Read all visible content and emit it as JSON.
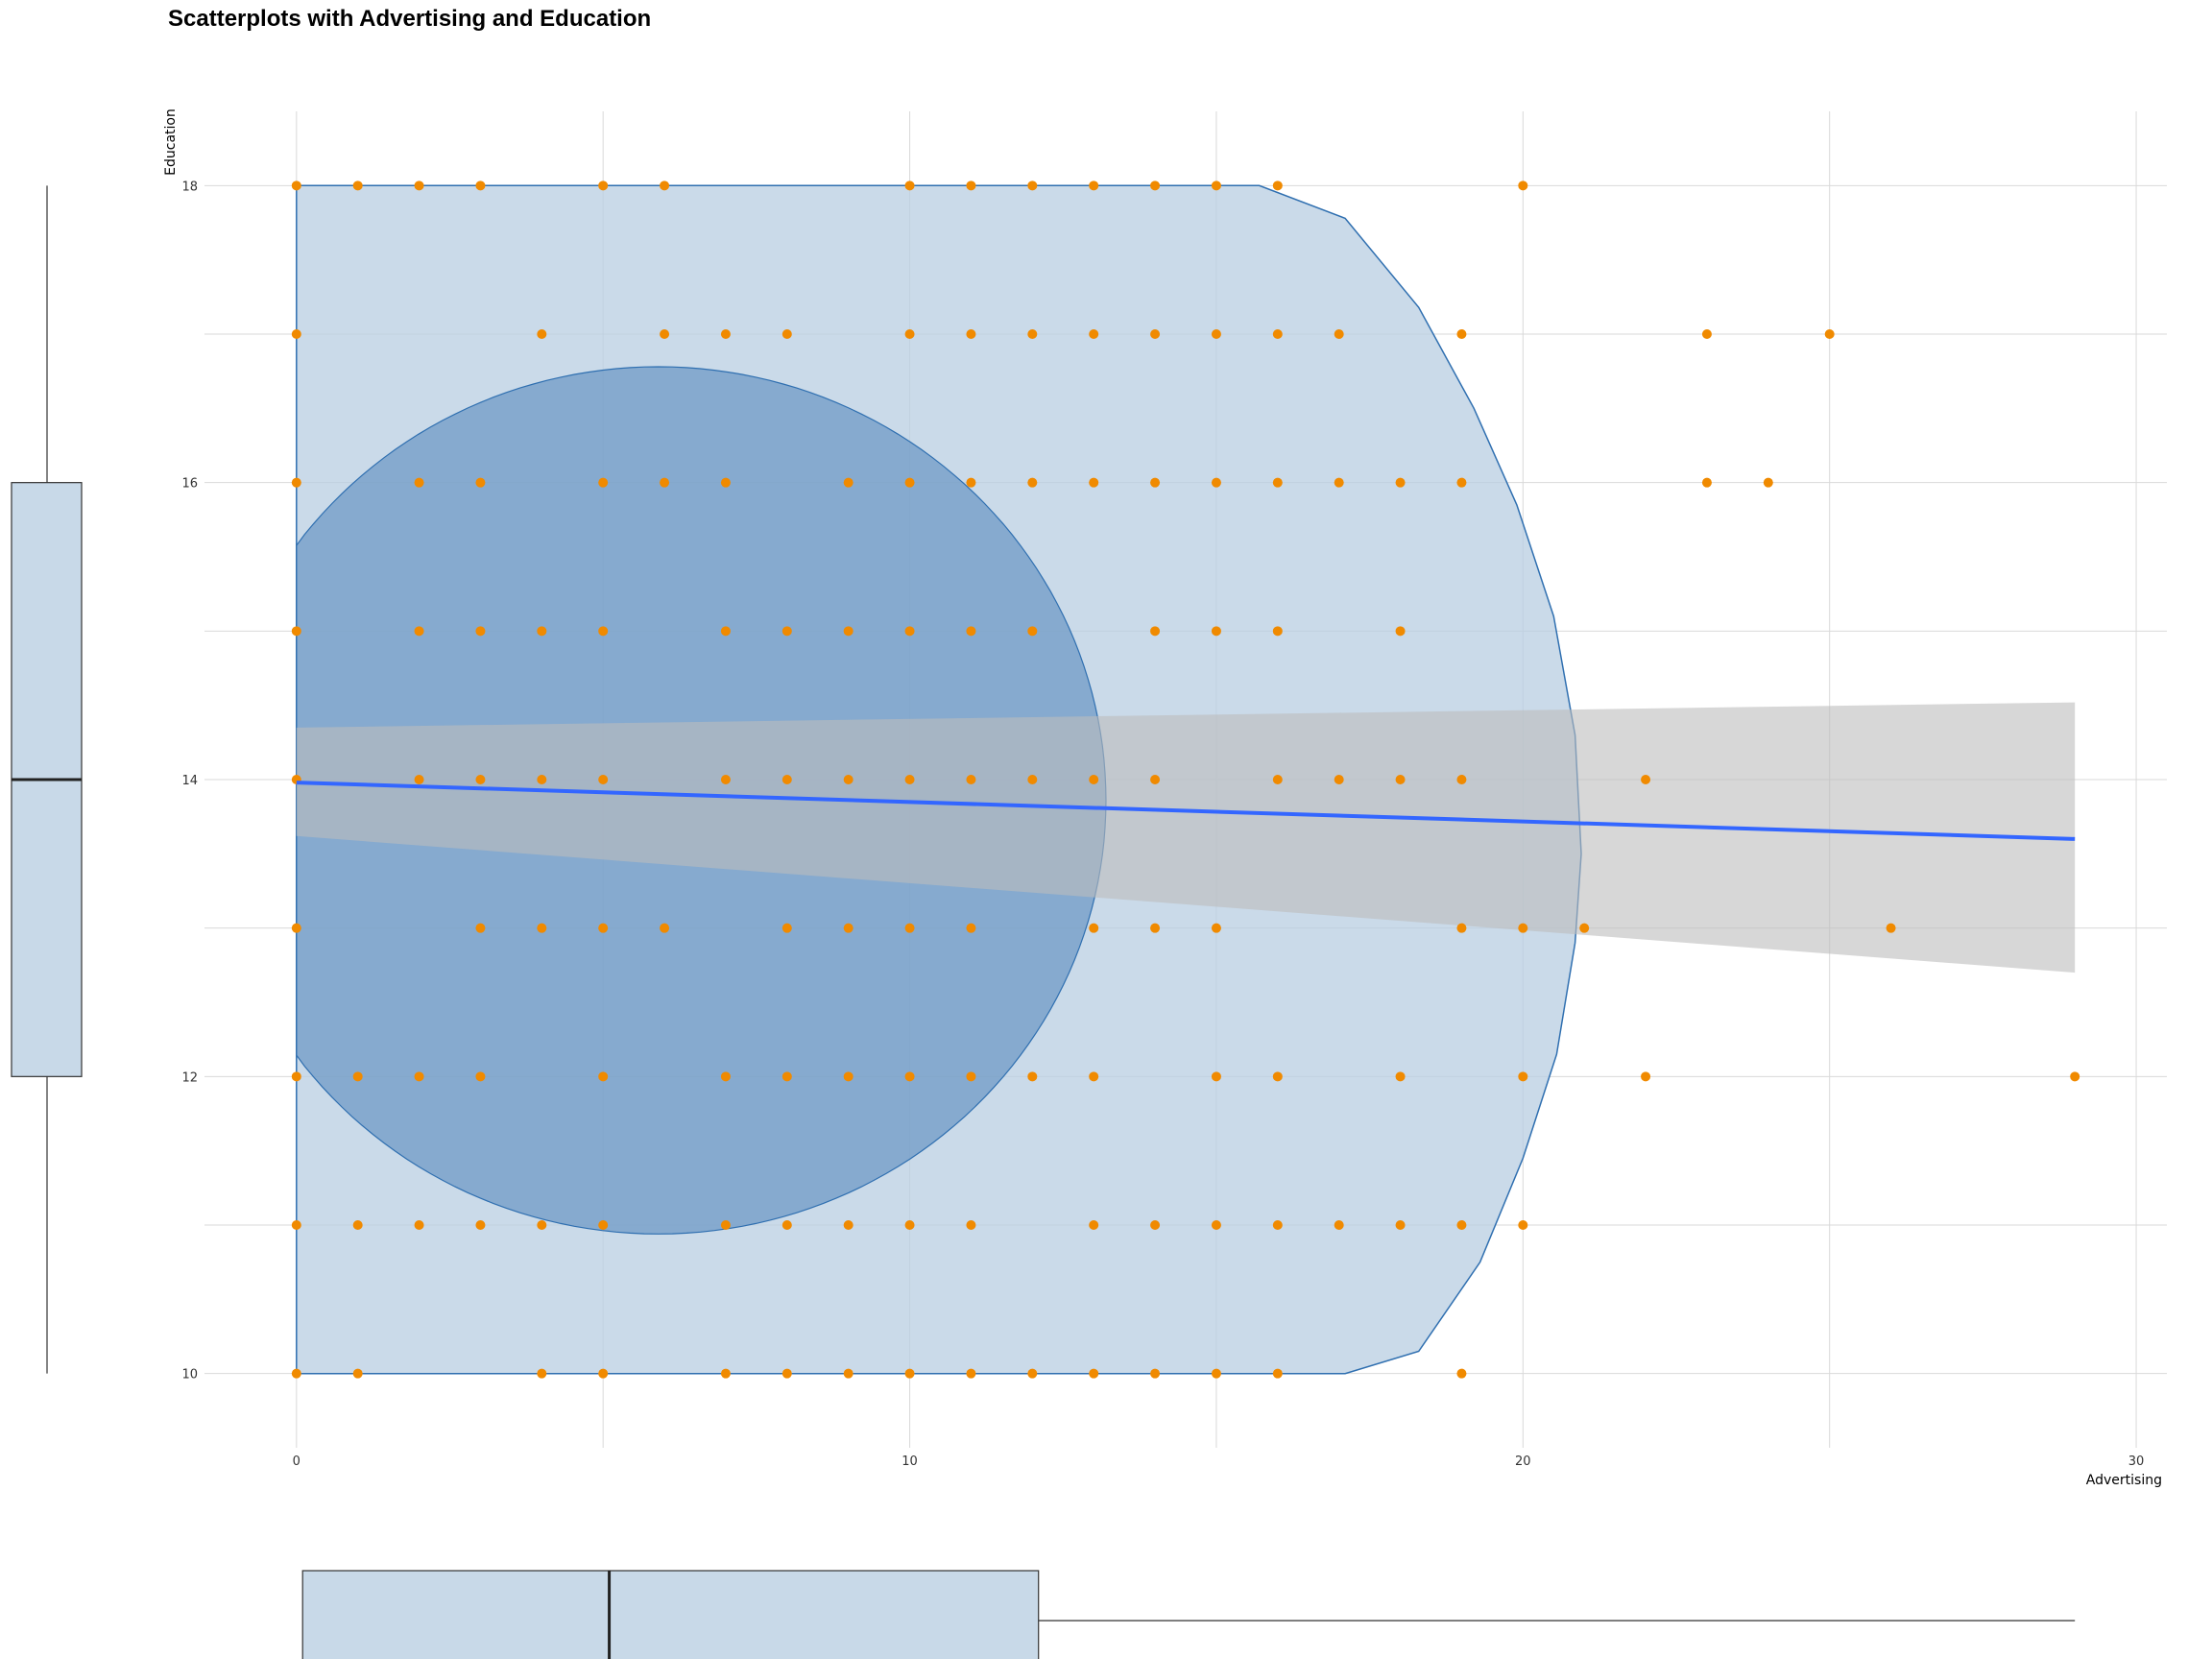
{
  "colors": {
    "points": "#f08a00",
    "fit_line": "#3366ff",
    "confidence_band": "#bdbdbd",
    "hull_fill": "#b8cde2",
    "hull_stroke": "#2f6fb0",
    "ellipse_fill": "#6f9ac6",
    "boxplot_fill": "#c8d9e8",
    "grid": "#d9d9d9"
  },
  "chart_data": {
    "type": "scatter",
    "title": "Scatterplots with Advertising and Education",
    "xlabel": "Advertising",
    "ylabel": "Education",
    "xlim": [
      -1.5,
      30.5
    ],
    "ylim": [
      9.5,
      18.5
    ],
    "x_ticks": [
      0,
      10,
      20,
      30
    ],
    "y_ticks": [
      10,
      12,
      14,
      16,
      18
    ],
    "grid": true,
    "points": [
      [
        0,
        18
      ],
      [
        1,
        18
      ],
      [
        2,
        18
      ],
      [
        3,
        18
      ],
      [
        5,
        18
      ],
      [
        6,
        18
      ],
      [
        10,
        18
      ],
      [
        11,
        18
      ],
      [
        12,
        18
      ],
      [
        13,
        18
      ],
      [
        14,
        18
      ],
      [
        15,
        18
      ],
      [
        16,
        18
      ],
      [
        20,
        18
      ],
      [
        0,
        17
      ],
      [
        4,
        17
      ],
      [
        6,
        17
      ],
      [
        7,
        17
      ],
      [
        8,
        17
      ],
      [
        10,
        17
      ],
      [
        11,
        17
      ],
      [
        12,
        17
      ],
      [
        13,
        17
      ],
      [
        14,
        17
      ],
      [
        15,
        17
      ],
      [
        16,
        17
      ],
      [
        17,
        17
      ],
      [
        19,
        17
      ],
      [
        23,
        17
      ],
      [
        25,
        17
      ],
      [
        0,
        16
      ],
      [
        2,
        16
      ],
      [
        3,
        16
      ],
      [
        5,
        16
      ],
      [
        6,
        16
      ],
      [
        7,
        16
      ],
      [
        9,
        16
      ],
      [
        10,
        16
      ],
      [
        11,
        16
      ],
      [
        12,
        16
      ],
      [
        13,
        16
      ],
      [
        14,
        16
      ],
      [
        15,
        16
      ],
      [
        16,
        16
      ],
      [
        17,
        16
      ],
      [
        18,
        16
      ],
      [
        19,
        16
      ],
      [
        23,
        16
      ],
      [
        24,
        16
      ],
      [
        0,
        15
      ],
      [
        2,
        15
      ],
      [
        3,
        15
      ],
      [
        4,
        15
      ],
      [
        5,
        15
      ],
      [
        7,
        15
      ],
      [
        8,
        15
      ],
      [
        9,
        15
      ],
      [
        10,
        15
      ],
      [
        11,
        15
      ],
      [
        12,
        15
      ],
      [
        14,
        15
      ],
      [
        15,
        15
      ],
      [
        16,
        15
      ],
      [
        18,
        15
      ],
      [
        0,
        14
      ],
      [
        2,
        14
      ],
      [
        3,
        14
      ],
      [
        4,
        14
      ],
      [
        5,
        14
      ],
      [
        7,
        14
      ],
      [
        8,
        14
      ],
      [
        9,
        14
      ],
      [
        10,
        14
      ],
      [
        11,
        14
      ],
      [
        12,
        14
      ],
      [
        13,
        14
      ],
      [
        14,
        14
      ],
      [
        16,
        14
      ],
      [
        17,
        14
      ],
      [
        18,
        14
      ],
      [
        19,
        14
      ],
      [
        22,
        14
      ],
      [
        0,
        13
      ],
      [
        3,
        13
      ],
      [
        4,
        13
      ],
      [
        5,
        13
      ],
      [
        6,
        13
      ],
      [
        8,
        13
      ],
      [
        9,
        13
      ],
      [
        10,
        13
      ],
      [
        11,
        13
      ],
      [
        13,
        13
      ],
      [
        14,
        13
      ],
      [
        15,
        13
      ],
      [
        19,
        13
      ],
      [
        20,
        13
      ],
      [
        21,
        13
      ],
      [
        26,
        13
      ],
      [
        0,
        12
      ],
      [
        1,
        12
      ],
      [
        2,
        12
      ],
      [
        3,
        12
      ],
      [
        5,
        12
      ],
      [
        7,
        12
      ],
      [
        8,
        12
      ],
      [
        9,
        12
      ],
      [
        10,
        12
      ],
      [
        11,
        12
      ],
      [
        12,
        12
      ],
      [
        13,
        12
      ],
      [
        15,
        12
      ],
      [
        16,
        12
      ],
      [
        18,
        12
      ],
      [
        20,
        12
      ],
      [
        22,
        12
      ],
      [
        29,
        12
      ],
      [
        0,
        11
      ],
      [
        1,
        11
      ],
      [
        2,
        11
      ],
      [
        3,
        11
      ],
      [
        4,
        11
      ],
      [
        5,
        11
      ],
      [
        7,
        11
      ],
      [
        8,
        11
      ],
      [
        9,
        11
      ],
      [
        10,
        11
      ],
      [
        11,
        11
      ],
      [
        13,
        11
      ],
      [
        14,
        11
      ],
      [
        15,
        11
      ],
      [
        16,
        11
      ],
      [
        17,
        11
      ],
      [
        18,
        11
      ],
      [
        19,
        11
      ],
      [
        20,
        11
      ],
      [
        0,
        10
      ],
      [
        1,
        10
      ],
      [
        4,
        10
      ],
      [
        5,
        10
      ],
      [
        7,
        10
      ],
      [
        8,
        10
      ],
      [
        9,
        10
      ],
      [
        10,
        10
      ],
      [
        11,
        10
      ],
      [
        12,
        10
      ],
      [
        13,
        10
      ],
      [
        14,
        10
      ],
      [
        15,
        10
      ],
      [
        16,
        10
      ],
      [
        19,
        10
      ]
    ],
    "regression": {
      "x": [
        0,
        29
      ],
      "y": [
        13.98,
        13.6
      ],
      "band_upper": [
        14.35,
        14.52
      ],
      "band_lower": [
        13.62,
        12.7
      ]
    },
    "hull": [
      [
        0,
        18
      ],
      [
        15.7,
        18
      ],
      [
        17.1,
        17.78
      ],
      [
        18.3,
        17.18
      ],
      [
        19.2,
        16.5
      ],
      [
        19.9,
        15.85
      ],
      [
        20.5,
        15.1
      ],
      [
        20.85,
        14.3
      ],
      [
        20.95,
        13.5
      ],
      [
        20.85,
        12.9
      ],
      [
        20.55,
        12.15
      ],
      [
        20,
        11.45
      ],
      [
        19.3,
        10.75
      ],
      [
        18.3,
        10.15
      ],
      [
        17.1,
        10
      ],
      [
        0,
        10
      ]
    ],
    "ellipse": {
      "cx": 5.9,
      "cy": 13.86,
      "rx": 7.3,
      "ry": 2.92,
      "clip_x_min": 0
    },
    "boxplot_x": {
      "min": 0,
      "q1": 0.1,
      "median": 5.1,
      "q3": 12.1,
      "max": 29
    },
    "boxplot_y": {
      "min": 10,
      "q1": 12,
      "median": 14,
      "q3": 16,
      "max": 18
    }
  }
}
